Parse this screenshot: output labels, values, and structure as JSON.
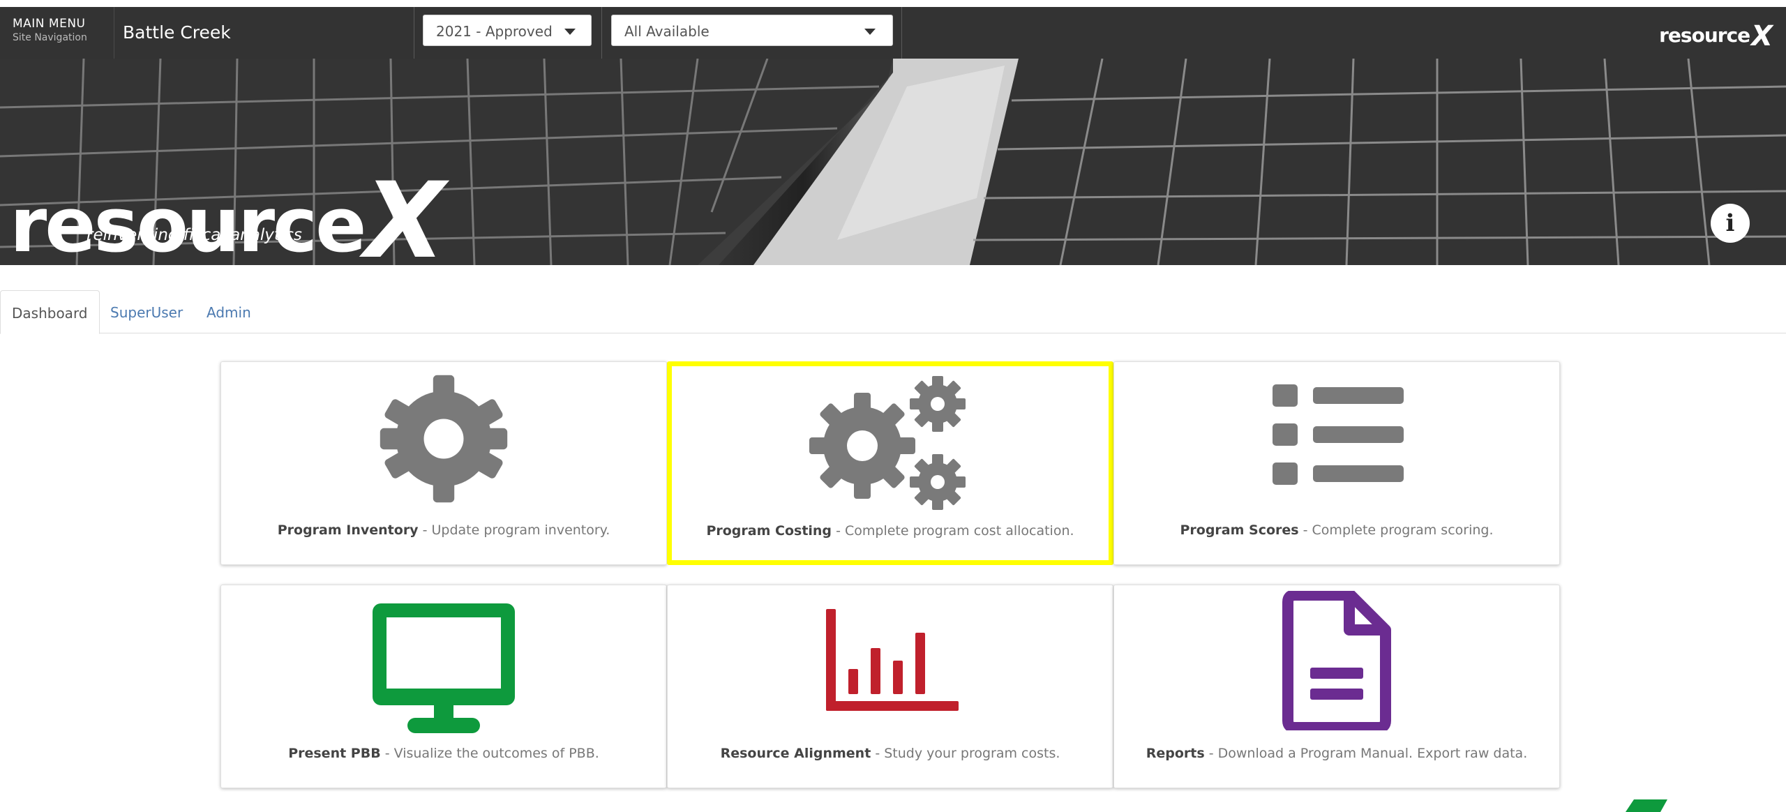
{
  "nav": {
    "menu_label": "MAIN MENU",
    "menu_sub": "Site Navigation",
    "site_title": "Battle Creek",
    "budget_select": "2021 - Approved",
    "filter_select": "All Available",
    "brand": "resource",
    "brand_x": "X"
  },
  "hero": {
    "logo": "resource",
    "logo_x": "X",
    "tagline": "reinventing fiscal analytics",
    "info": "i"
  },
  "tabs": [
    {
      "label": "Dashboard"
    },
    {
      "label": "SuperUser"
    },
    {
      "label": "Admin"
    }
  ],
  "cards": [
    {
      "title": "Program Inventory",
      "desc": " - Update program inventory.",
      "icon": "gear-icon",
      "color": "#7a7a7a"
    },
    {
      "title": "Program Costing",
      "desc": " - Complete program cost allocation.",
      "icon": "gears-icon",
      "color": "#7a7a7a"
    },
    {
      "title": "Program Scores",
      "desc": " - Complete program scoring.",
      "icon": "list-icon",
      "color": "#7a7a7a"
    },
    {
      "title": "Present PBB",
      "desc": " - Visualize the outcomes of PBB.",
      "icon": "monitor-icon",
      "color": "#0e9a3d"
    },
    {
      "title": "Resource Alignment",
      "desc": " - Study your program costs.",
      "icon": "bar-chart-icon",
      "color": "#c0202c"
    },
    {
      "title": "Reports",
      "desc": " - Download a Program Manual. Export raw data.",
      "icon": "document-icon",
      "color": "#6b2c91"
    }
  ],
  "colors": {
    "topbar": "#333333",
    "highlight": "#ffff00",
    "link": "#4c7ab0"
  }
}
